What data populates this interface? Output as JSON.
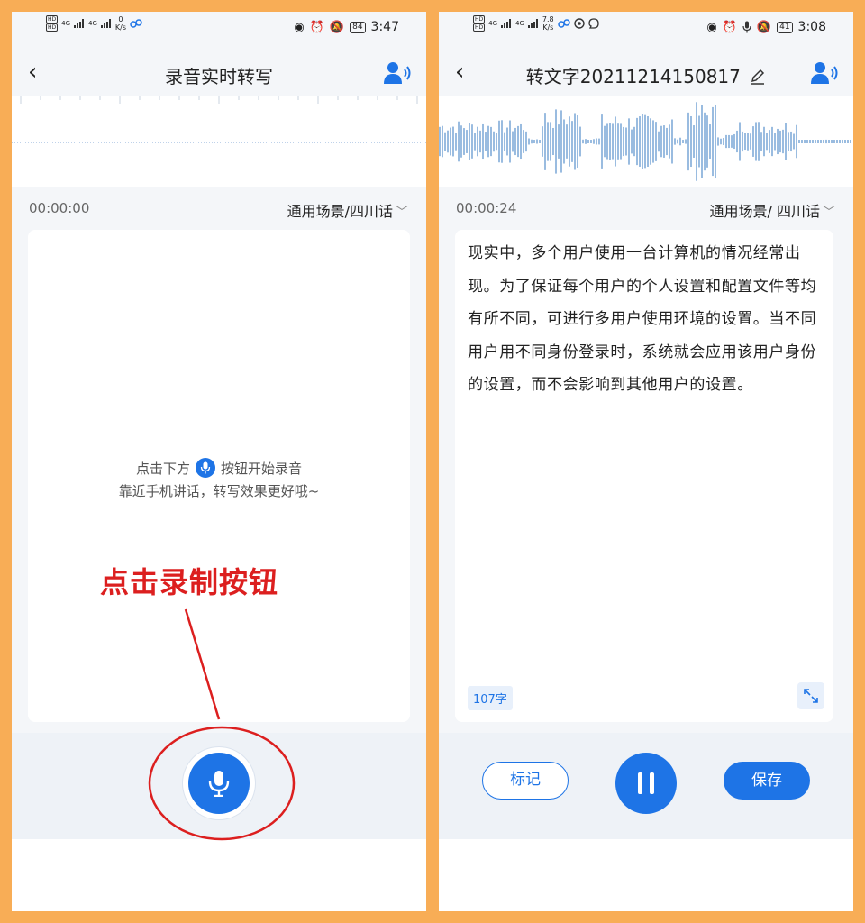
{
  "left": {
    "status": {
      "speed_value": "0",
      "speed_unit": "K/s",
      "battery": "84",
      "time": "3:47"
    },
    "title": "录音实时转写",
    "timer": "00:00:00",
    "scene": "通用场景/四川话",
    "hint_before": "点击下方",
    "hint_after": "按钮开始录音",
    "hint_line2": "靠近手机讲话，转写效果更好哦~",
    "annotation": "点击录制按钮"
  },
  "right": {
    "status": {
      "speed_value": "7.8",
      "speed_unit": "K/s",
      "battery": "41",
      "time": "3:08"
    },
    "title": "转文字20211214150817",
    "timer": "00:00:24",
    "scene": "通用场景/ 四川话",
    "transcript": "现实中，多个用户使用一台计算机的情况经常出现。为了保证每个用户的个人设置和配置文件等均有所不同，可进行多用户使用环境的设置。当不同用户用不同身份登录时，系统就会应用该用户身份的设置，而不会影响到其他用户的设置。",
    "word_count": "107字",
    "mark_label": "标记",
    "save_label": "保存"
  },
  "status_labels": {
    "hd": "HD",
    "net": "4G"
  },
  "icons": [
    "eye-icon",
    "alarm-icon",
    "mute-icon",
    "mic-icon",
    "pencil-icon",
    "speaker-icon",
    "chevron-down-icon",
    "expand-icon",
    "back-icon"
  ],
  "colors": {
    "accent": "#1e74e6",
    "frame": "#f8ad56",
    "annotation": "#dc1f1f"
  }
}
